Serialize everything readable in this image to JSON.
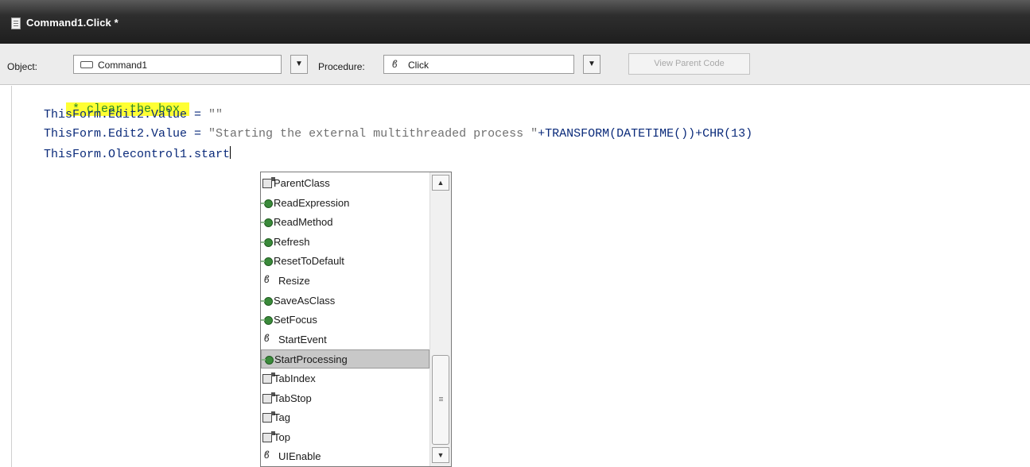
{
  "window": {
    "title": "Command1.Click *"
  },
  "toolbar": {
    "object_label": "Object:",
    "object_value": "Command1",
    "procedure_label": "Procedure:",
    "procedure_value": "Click",
    "view_parent_code": "View Parent Code"
  },
  "code": {
    "lines": [
      {
        "comment": "* clear the box"
      },
      {
        "text": "ThisForm.Edit2.Value = ",
        "string": "\"\""
      },
      {
        "text": "ThisForm.Edit2.Value = ",
        "string": "\"Starting the external multithreaded process \"",
        "tail": "+TRANSFORM(DATETIME())+CHR(13)"
      },
      {
        "text": "ThisForm.Olecontrol1.start"
      }
    ]
  },
  "autocomplete": {
    "selected": "StartProcessing",
    "items": [
      {
        "label": "ParentClass",
        "icon": "property-icon"
      },
      {
        "label": "ReadExpression",
        "icon": "method-icon"
      },
      {
        "label": "ReadMethod",
        "icon": "method-icon"
      },
      {
        "label": "Refresh",
        "icon": "method-icon"
      },
      {
        "label": "ResetToDefault",
        "icon": "method-icon"
      },
      {
        "label": "Resize",
        "icon": "event-icon"
      },
      {
        "label": "SaveAsClass",
        "icon": "method-icon"
      },
      {
        "label": "SetFocus",
        "icon": "method-icon"
      },
      {
        "label": "StartEvent",
        "icon": "event-icon"
      },
      {
        "label": "StartProcessing",
        "icon": "method-icon"
      },
      {
        "label": "TabIndex",
        "icon": "property-icon"
      },
      {
        "label": "TabStop",
        "icon": "property-icon"
      },
      {
        "label": "Tag",
        "icon": "property-icon"
      },
      {
        "label": "Top",
        "icon": "property-icon"
      },
      {
        "label": "UIEnable",
        "icon": "event-icon"
      }
    ]
  },
  "colors": {
    "code_text": "#0a2a7a",
    "comment": "#2a8a2a",
    "comment_highlight": "#ffff33",
    "string": "#707070"
  }
}
